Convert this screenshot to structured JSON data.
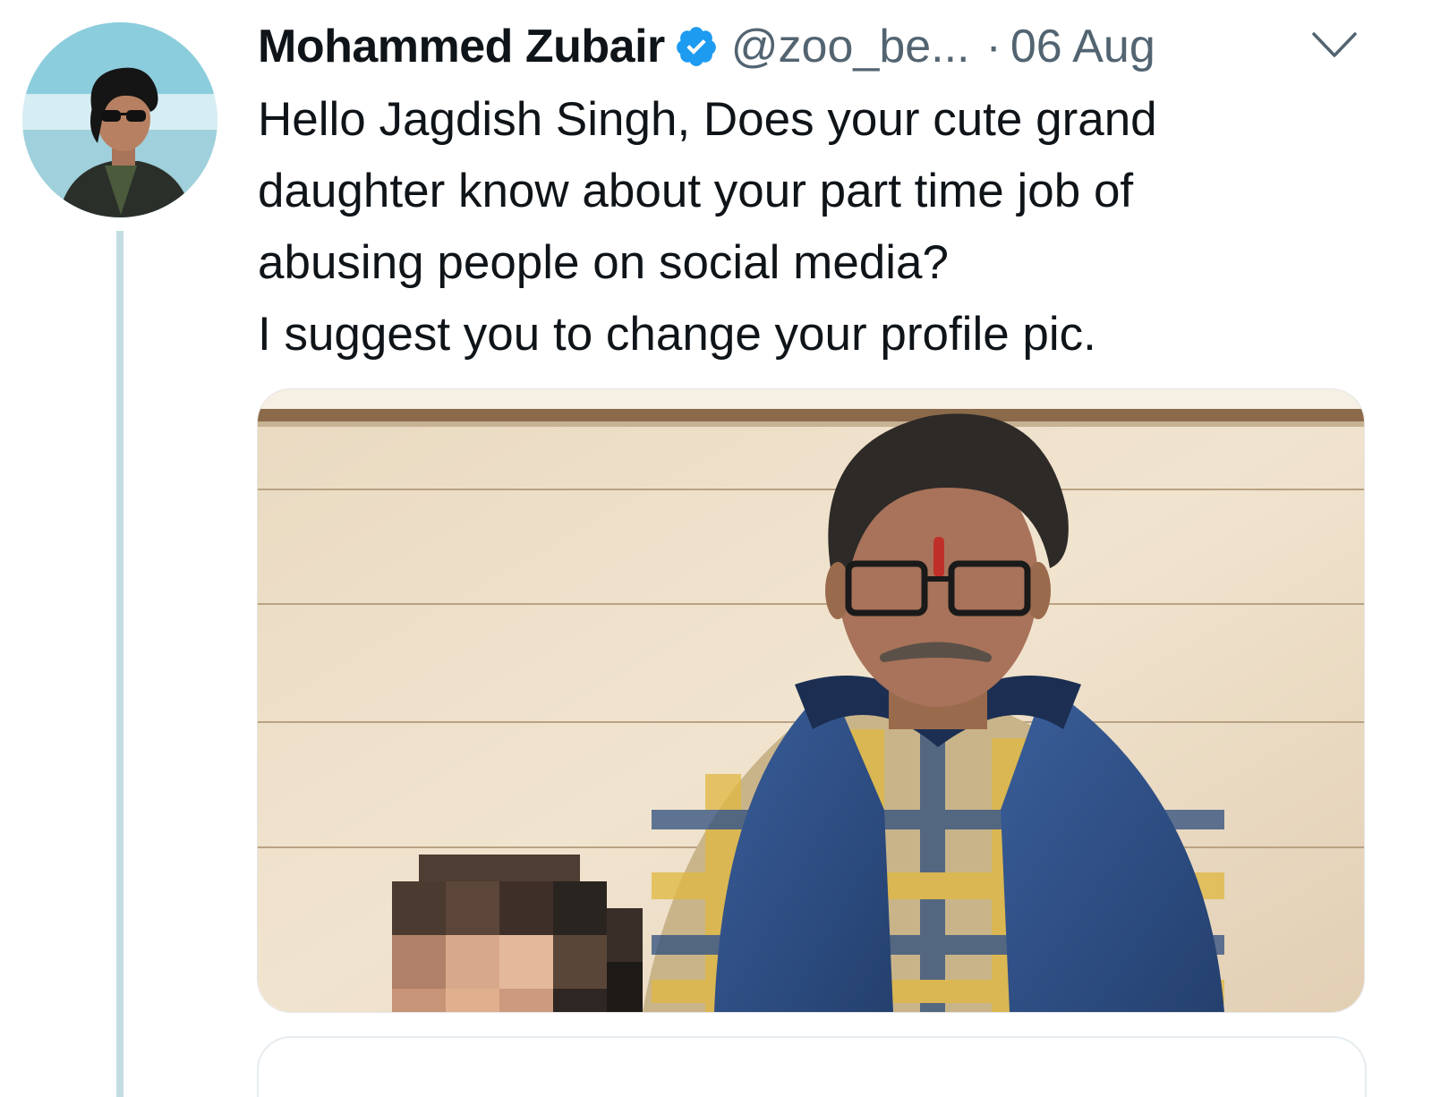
{
  "tweet": {
    "author": {
      "name": "Mohammed Zubair",
      "handle": "@zoo_be...",
      "verified": true,
      "avatar_icon": "user-avatar-photo"
    },
    "separator": "·",
    "date": "06 Aug",
    "menu_icon": "chevron-down-icon",
    "text_lines": [
      "Hello Jagdish Singh, Does your cute grand",
      "daughter know about your part time job of",
      "abusing people on social media?",
      "I suggest you to change your profile pic."
    ],
    "media": {
      "type": "photo",
      "icon": "tweet-photo"
    }
  },
  "colors": {
    "verified": "#1d9bf0",
    "secondary_text": "#536471",
    "thread_line": "#c4dde3"
  }
}
